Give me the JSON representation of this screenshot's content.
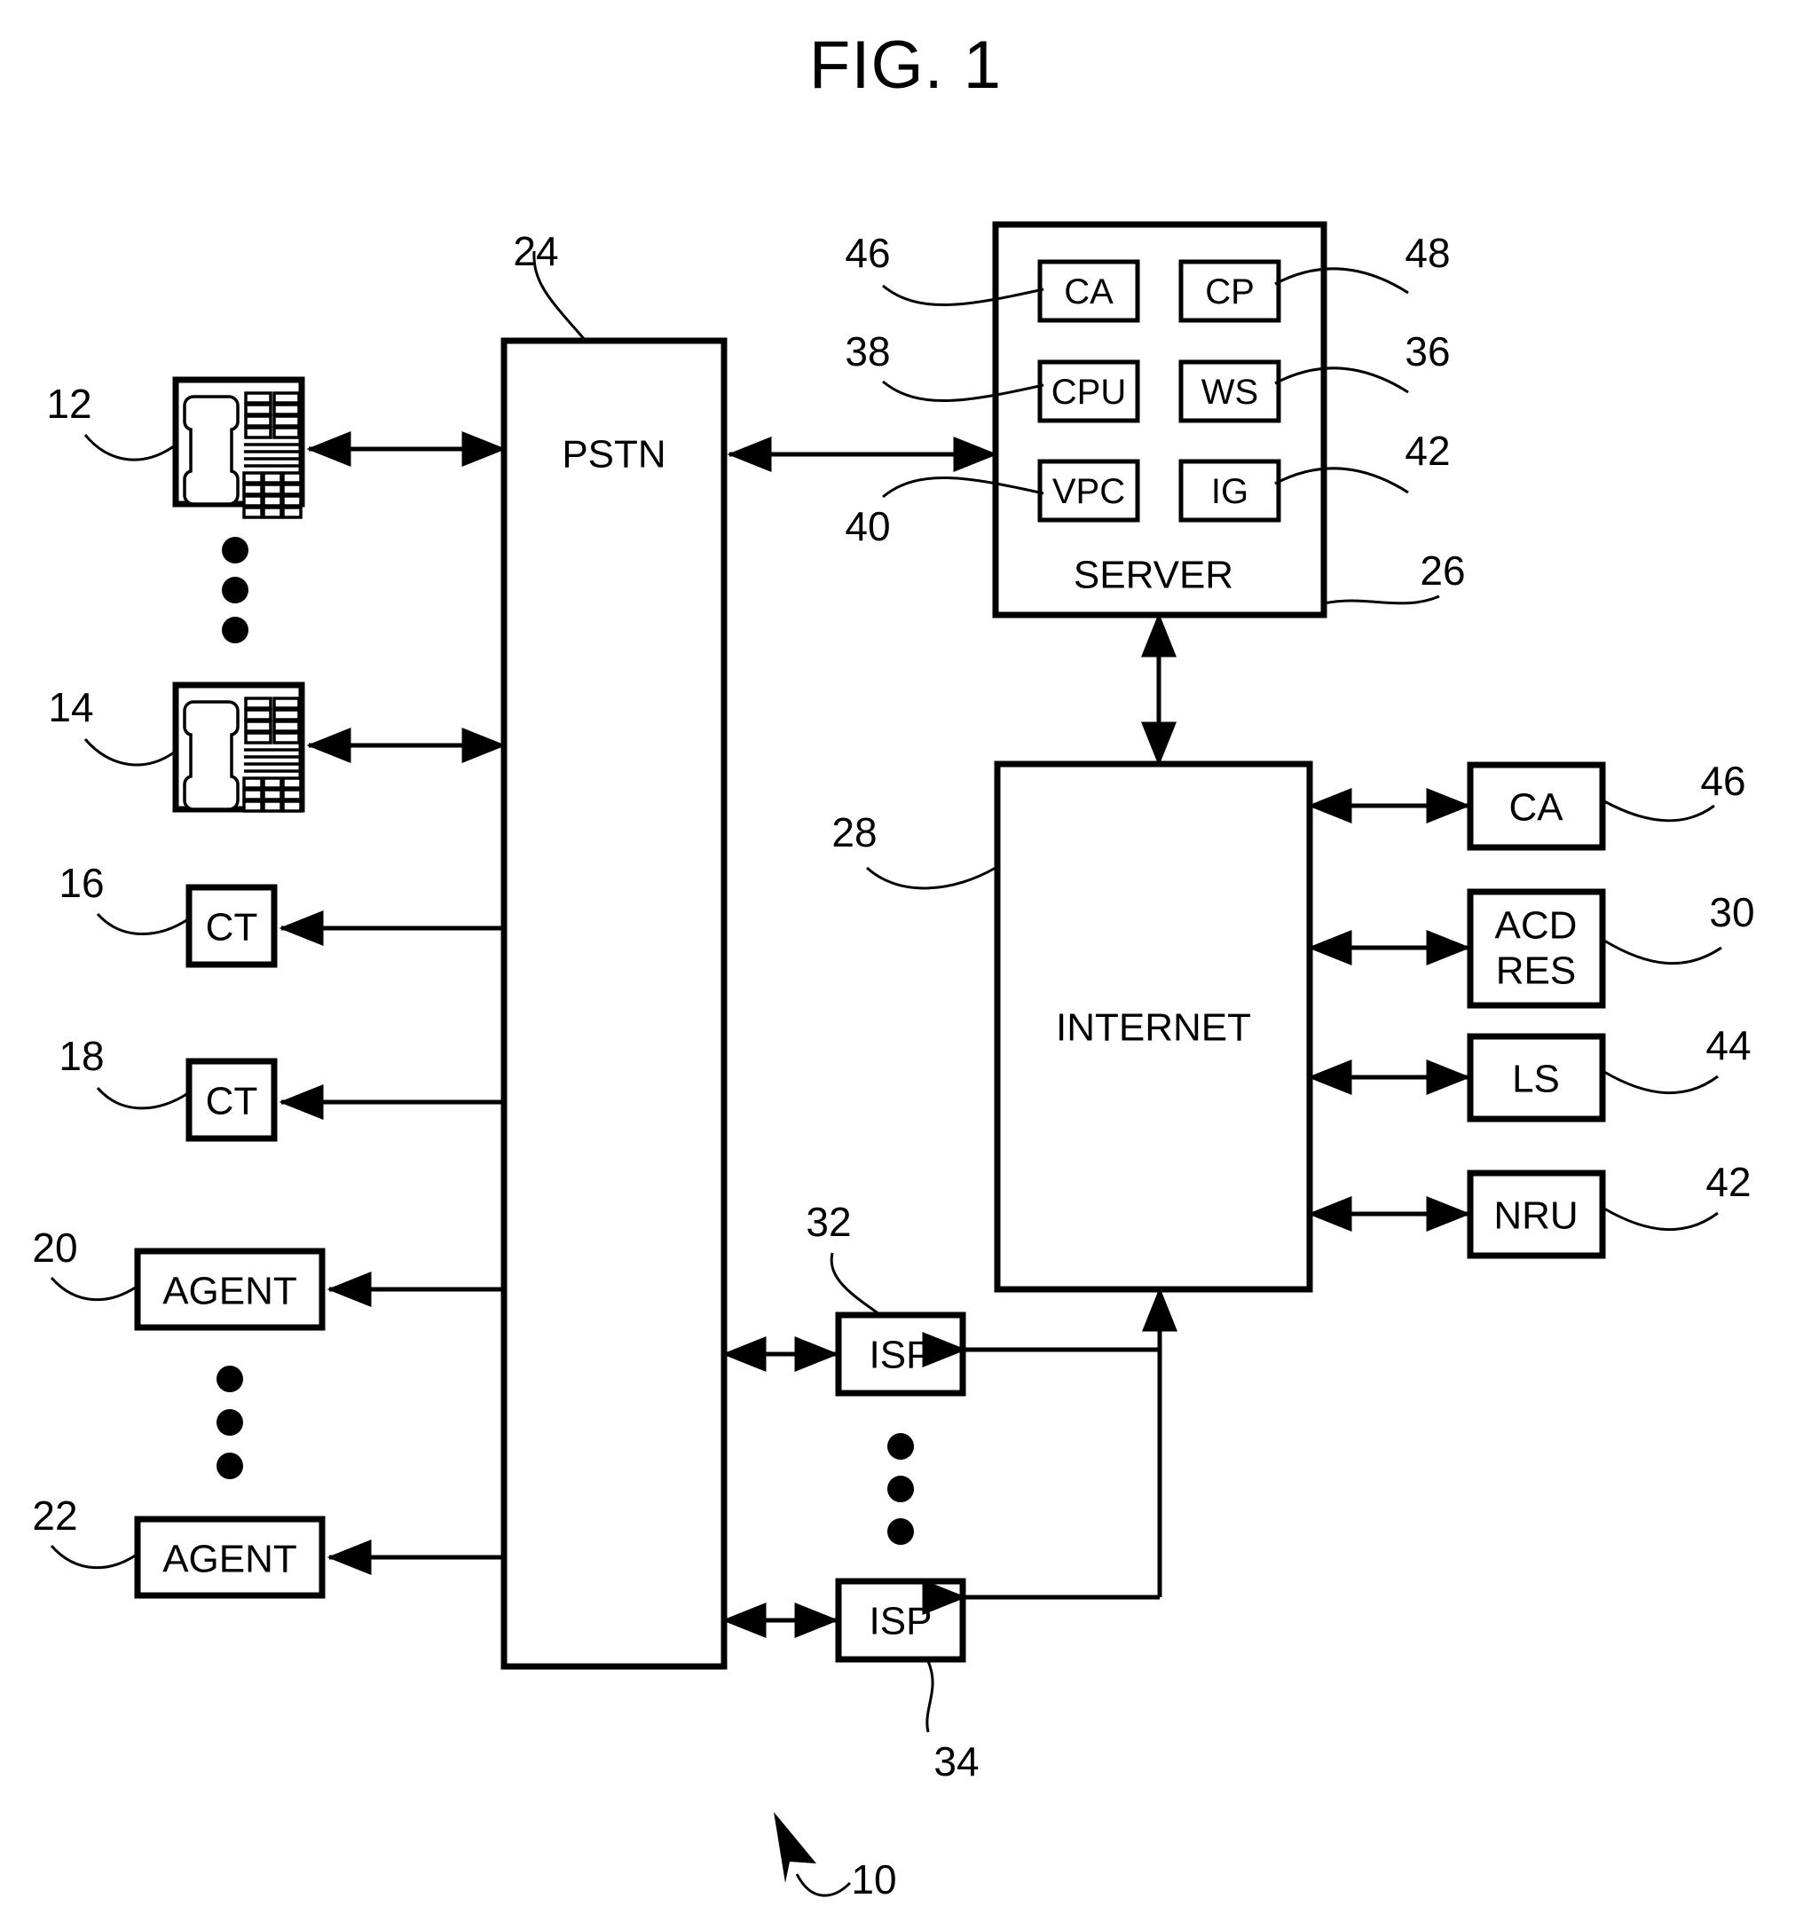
{
  "figure": {
    "title": "FIG. 1",
    "system_ref": "10"
  },
  "nodes": {
    "phone_top": {
      "ref": "12",
      "kind": "telephone-icon"
    },
    "phone_bottom": {
      "ref": "14",
      "kind": "telephone-icon"
    },
    "ct_top": {
      "label": "CT",
      "ref": "16"
    },
    "ct_bottom": {
      "label": "CT",
      "ref": "18"
    },
    "agent_top": {
      "label": "AGENT",
      "ref": "20"
    },
    "agent_bottom": {
      "label": "AGENT",
      "ref": "22"
    },
    "pstn": {
      "label": "PSTN",
      "ref": "24"
    },
    "server": {
      "label": "SERVER",
      "ref": "26"
    },
    "internet": {
      "label": "INTERNET",
      "ref": "28"
    },
    "isp_top": {
      "label": "ISP",
      "ref": "32"
    },
    "isp_bottom": {
      "label": "ISP",
      "ref": "34"
    }
  },
  "server_modules": [
    {
      "label": "CA",
      "ref": "46",
      "side": "left"
    },
    {
      "label": "CP",
      "ref": "48",
      "side": "right"
    },
    {
      "label": "CPU",
      "ref": "38",
      "side": "left"
    },
    {
      "label": "WS",
      "ref": "36",
      "side": "right"
    },
    {
      "label": "VPC",
      "ref": "40",
      "side": "left"
    },
    {
      "label": "IG",
      "ref": "42",
      "side": "right"
    }
  ],
  "internet_peers": [
    {
      "label": "CA",
      "ref": "46"
    },
    {
      "label": "ACD",
      "label2": "RES",
      "ref": "30"
    },
    {
      "label": "LS",
      "ref": "44"
    },
    {
      "label": "NRU",
      "ref": "42"
    }
  ],
  "colors": {
    "ink": "#000000",
    "paper": "#ffffff"
  }
}
